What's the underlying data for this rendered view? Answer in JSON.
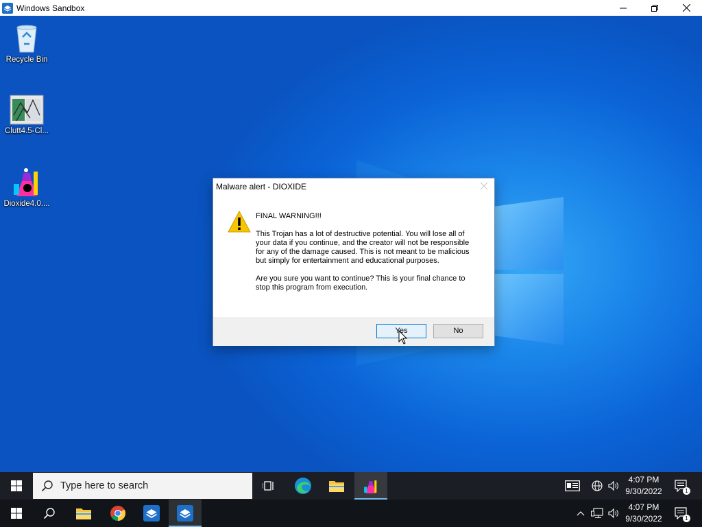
{
  "window": {
    "title": "Windows Sandbox"
  },
  "desktop": {
    "icons": [
      {
        "label": "Recycle Bin"
      },
      {
        "label": "Clutt4.5-Cl..."
      },
      {
        "label": "Dioxide4.0...."
      }
    ]
  },
  "dialog": {
    "title": "Malware alert - DIOXIDE",
    "heading": "FINAL WARNING!!!",
    "paragraph1": "This Trojan has a lot of destructive potential. You will lose all of your data if you continue, and the creator will not be responsible for any of the damage caused. This is not meant to be malicious but simply for entertainment and educational purposes.",
    "paragraph2": "Are you sure you want to continue? This is your final chance to stop this program from execution.",
    "yes_label": "Yes",
    "no_label": "No"
  },
  "taskbar_top": {
    "search_placeholder": "Type here to search",
    "time": "4:07 PM",
    "date": "9/30/2022",
    "notification_count": "1"
  },
  "taskbar_bottom": {
    "time": "4:07 PM",
    "date": "9/30/2022",
    "notification_count": "1"
  },
  "colors": {
    "desktop_blue": "#0a5fd0",
    "button_focus_border": "#0078d7",
    "warning_yellow": "#f7c600"
  }
}
